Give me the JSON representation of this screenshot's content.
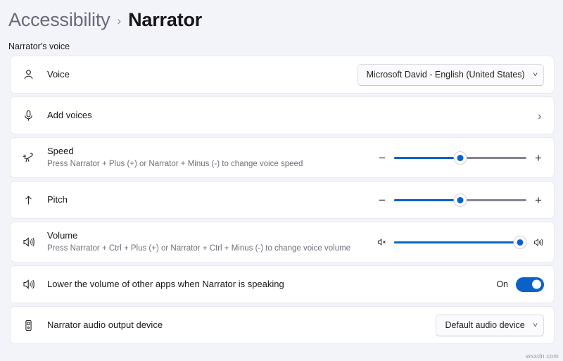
{
  "breadcrumb": {
    "parent": "Accessibility",
    "separator": "›",
    "current": "Narrator"
  },
  "section": {
    "label": "Narrator's voice"
  },
  "rows": {
    "voice": {
      "icon": "person-icon",
      "title": "Voice",
      "control": "dropdown",
      "value": "Microsoft David - English (United States)",
      "chevron": "˅"
    },
    "add_voices": {
      "icon": "microphone-icon",
      "title": "Add voices",
      "control": "navigate",
      "chevron": "›"
    },
    "speed": {
      "icon": "speed-rabbit-icon",
      "title": "Speed",
      "subtitle": "Press Narrator + Plus (+) or Narrator + Minus (-) to change voice speed",
      "control": "slider",
      "percent": 50,
      "left_glyph": "−",
      "right_glyph": "+",
      "left_icon": "minus-icon",
      "right_icon": "plus-icon"
    },
    "pitch": {
      "icon": "up-arrow-icon",
      "title": "Pitch",
      "control": "slider",
      "percent": 50,
      "left_glyph": "−",
      "right_glyph": "+",
      "left_icon": "minus-icon",
      "right_icon": "plus-icon"
    },
    "volume": {
      "icon": "speaker-waves-icon",
      "title": "Volume",
      "subtitle": "Press Narrator + Ctrl + Plus (+) or Narrator + Ctrl + Minus (-) to change voice volume",
      "control": "slider",
      "percent": 95,
      "left_icon": "speaker-mute-icon",
      "right_icon": "speaker-loud-icon"
    },
    "lower_volume": {
      "icon": "speaker-waves-icon",
      "title": "Lower the volume of other apps when Narrator is speaking",
      "control": "toggle",
      "state_label": "On",
      "state_on": true
    },
    "audio_output": {
      "icon": "audio-output-device-icon",
      "title": "Narrator audio output device",
      "control": "dropdown",
      "value": "Default audio device",
      "chevron": "˅"
    }
  },
  "watermark": "wsxdn.com",
  "colors": {
    "page_background": "#f3f3fa",
    "card_background": "#ffffff",
    "accent": "#0a62c9",
    "track": "#868692",
    "title_text": "#161616",
    "muted_text": "#70707a"
  }
}
